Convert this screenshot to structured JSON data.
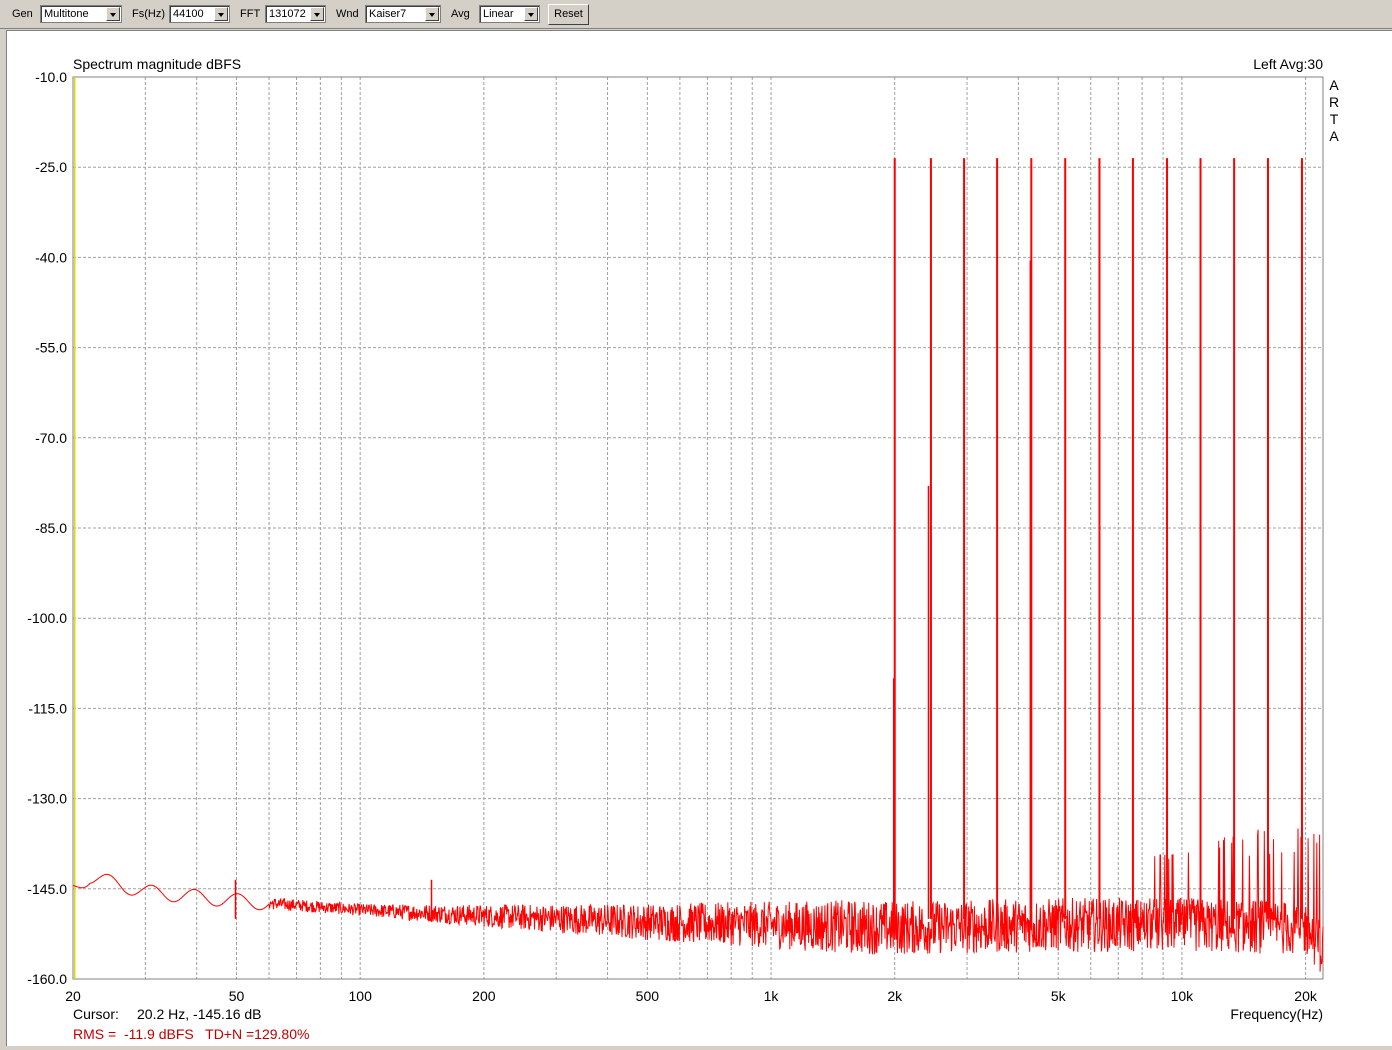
{
  "toolbar": {
    "gen_label": "Gen",
    "gen_value": "Multitone",
    "fs_label": "Fs(Hz)",
    "fs_value": "44100",
    "fft_label": "FFT",
    "fft_value": "131072",
    "wnd_label": "Wnd",
    "wnd_value": "Kaiser7",
    "avg_label": "Avg",
    "avg_value": "Linear",
    "reset_label": "Reset"
  },
  "plot": {
    "title": "Spectrum magnitude dBFS",
    "channel_info": "Left  Avg:30",
    "brand_letters": [
      "A",
      "R",
      "T",
      "A"
    ],
    "xlabel": "Frequency(Hz)",
    "cursor_label": "Cursor:",
    "cursor_value": "20.2 Hz, -145.16 dB",
    "rms_text": "RMS =  -11.9 dBFS   TD+N =129.80%"
  },
  "colors": {
    "trace": "#ff0000",
    "grid": "#a0a0a0",
    "cursor_line": "#e6d800",
    "rms_text": "#c00000"
  },
  "chart_data": {
    "type": "line",
    "title": "Spectrum magnitude dBFS",
    "xlabel": "Frequency(Hz)",
    "ylabel": "",
    "x_scale": "log",
    "xlim": [
      20,
      22050
    ],
    "ylim": [
      -160,
      -10
    ],
    "y_ticks": [
      "-10.0",
      "-25.0",
      "-40.0",
      "-55.0",
      "-70.0",
      "-85.0",
      "-100.0",
      "-115.0",
      "-130.0",
      "-145.0",
      "-160.0"
    ],
    "x_ticks": [
      {
        "f": 20,
        "label": "20"
      },
      {
        "f": 50,
        "label": "50"
      },
      {
        "f": 100,
        "label": "100"
      },
      {
        "f": 200,
        "label": "200"
      },
      {
        "f": 500,
        "label": "500"
      },
      {
        "f": 1000,
        "label": "1k"
      },
      {
        "f": 2000,
        "label": "2k"
      },
      {
        "f": 5000,
        "label": "5k"
      },
      {
        "f": 10000,
        "label": "10k"
      },
      {
        "f": 20000,
        "label": "20k"
      }
    ],
    "grid": true,
    "cursor_hz": 20.2,
    "tones": [
      {
        "f": 2000,
        "db": -23.5
      },
      {
        "f": 2450,
        "db": -23.5
      },
      {
        "f": 2950,
        "db": -23.5
      },
      {
        "f": 3550,
        "db": -23.5
      },
      {
        "f": 4300,
        "db": -23.5
      },
      {
        "f": 5200,
        "db": -23.5
      },
      {
        "f": 6300,
        "db": -23.5
      },
      {
        "f": 7600,
        "db": -23.5
      },
      {
        "f": 9200,
        "db": -23.5
      },
      {
        "f": 11100,
        "db": -23.5
      },
      {
        "f": 13400,
        "db": -23.5
      },
      {
        "f": 16200,
        "db": -23.5
      },
      {
        "f": 19600,
        "db": -23.5
      }
    ],
    "side_peaks": [
      {
        "f": 2000,
        "db": -110
      },
      {
        "f": 2430,
        "db": -78
      },
      {
        "f": 4300,
        "db": -40.5
      },
      {
        "f": 50,
        "db": -143.5
      },
      {
        "f": 150,
        "db": -143.5
      }
    ],
    "noise_floor": [
      {
        "f": 20,
        "db": -145
      },
      {
        "f": 22,
        "db": -143
      },
      {
        "f": 30,
        "db": -145.5
      },
      {
        "f": 50,
        "db": -147
      },
      {
        "f": 100,
        "db": -148.5
      },
      {
        "f": 200,
        "db": -149.5
      },
      {
        "f": 500,
        "db": -150.5
      },
      {
        "f": 1000,
        "db": -151
      },
      {
        "f": 2000,
        "db": -151.5
      },
      {
        "f": 5000,
        "db": -151
      },
      {
        "f": 10000,
        "db": -151
      },
      {
        "f": 20000,
        "db": -151.5
      },
      {
        "f": 22050,
        "db": -155
      }
    ]
  }
}
